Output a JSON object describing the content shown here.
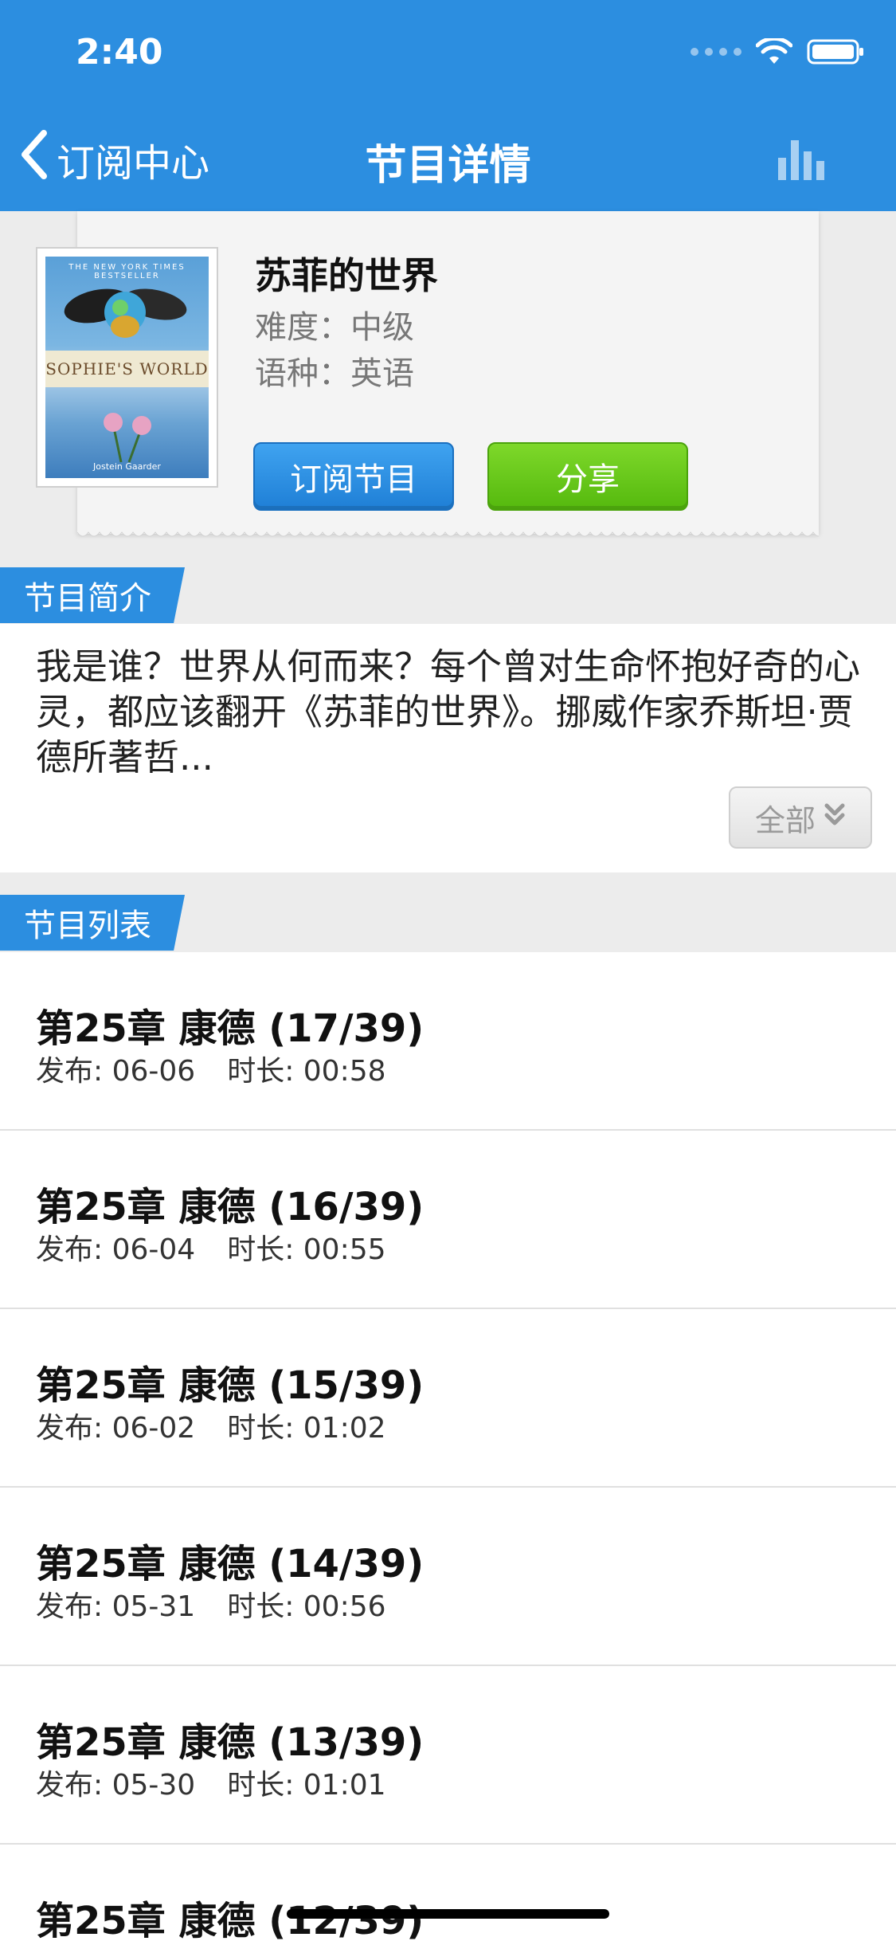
{
  "status": {
    "time": "2:40"
  },
  "nav": {
    "back_label": "订阅中心",
    "title": "节目详情"
  },
  "book": {
    "title": "苏菲的世界",
    "difficulty": "难度：中级",
    "language": "语种：英语",
    "cover_text": {
      "top": "THE NEW YORK TIMES BESTSELLER",
      "title": "SOPHIE'S WORLD",
      "author": "Jostein Gaarder"
    }
  },
  "actions": {
    "subscribe": "订阅节目",
    "share": "分享"
  },
  "sections": {
    "intro_label": "节目简介",
    "list_label": "节目列表"
  },
  "intro": {
    "text": "我是谁？世界从何而来？每个曾对生命怀抱好奇的心灵，都应该翻开《苏菲的世界》。挪威作家乔斯坦·贾德所著哲...",
    "more_label": "全部"
  },
  "episodes": [
    {
      "title": "第25章 康德 (17/39)",
      "release": "发布: 06-06",
      "duration": "时长: 00:58"
    },
    {
      "title": "第25章 康德 (16/39)",
      "release": "发布: 06-04",
      "duration": "时长: 00:55"
    },
    {
      "title": "第25章 康德 (15/39)",
      "release": "发布: 06-02",
      "duration": "时长: 01:02"
    },
    {
      "title": "第25章 康德 (14/39)",
      "release": "发布: 05-31",
      "duration": "时长: 00:56"
    },
    {
      "title": "第25章 康德 (13/39)",
      "release": "发布: 05-30",
      "duration": "时长: 01:01"
    },
    {
      "title": "第25章 康德 (12/39)",
      "release": "",
      "duration": ""
    }
  ],
  "colors": {
    "primary": "#2c8ee0",
    "share_green": "#6cc91b",
    "background": "#ececec"
  }
}
